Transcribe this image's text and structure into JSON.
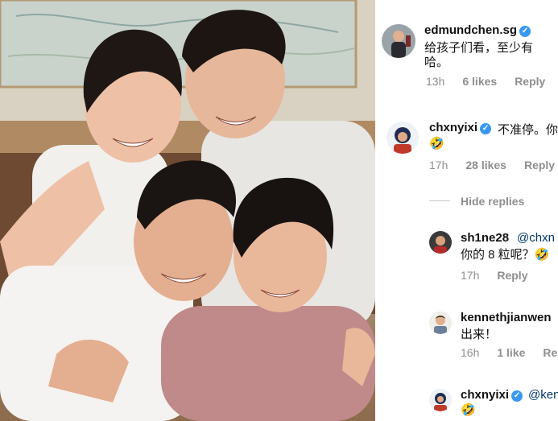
{
  "comments": [
    {
      "username": "edmundchen.sg",
      "verified": true,
      "text_line1": "给孩子们看，至少有",
      "text_line2": "哈。",
      "time": "13h",
      "likes": "6 likes",
      "reply": "Reply"
    },
    {
      "username": "chxnyixi",
      "verified": true,
      "text_line1": "不准停。你知",
      "text_line2": "🤣",
      "time": "17h",
      "likes": "28 likes",
      "reply": "Reply"
    }
  ],
  "hide_replies": "Hide replies",
  "replies": [
    {
      "username": "sh1ne28",
      "mention": "@chxn",
      "text_line2": "你的 8 粒呢？🤣",
      "time": "17h",
      "reply": "Reply"
    },
    {
      "username": "kennethjianwen",
      "text_line1": "出来！",
      "time": "16h",
      "likes": "1 like",
      "reply": "Repl"
    },
    {
      "username": "chxnyixi",
      "verified": true,
      "mention": "@ken",
      "text_line2": "🤣"
    }
  ],
  "colors": {
    "verified_badge": "#3897f0",
    "meta_text": "#8e8e8e",
    "mention": "#00376b"
  }
}
